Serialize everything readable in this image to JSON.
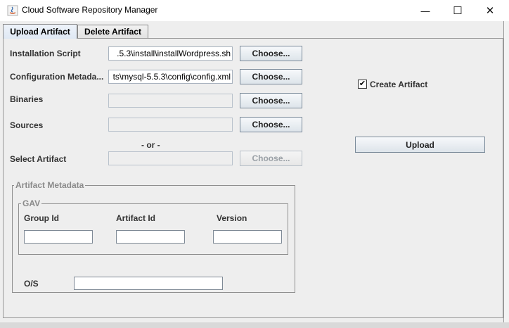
{
  "window": {
    "title": "Cloud Software Repository Manager",
    "controls": {
      "minimize": "—",
      "maximize": "☐",
      "close": "✕"
    }
  },
  "tabs": [
    {
      "label": "Upload Artifact",
      "selected": true
    },
    {
      "label": "Delete Artifact",
      "selected": false
    }
  ],
  "form": {
    "installation_script": {
      "label": "Installation Script",
      "value": ".5.3\\install\\installWordpress.sh",
      "button": "Choose..."
    },
    "configuration_metadata": {
      "label": "Configuration Metada...",
      "value": "ts\\mysql-5.5.3\\config\\config.xml",
      "button": "Choose..."
    },
    "binaries": {
      "label": "Binaries",
      "value": "",
      "button": "Choose..."
    },
    "sources": {
      "label": "Sources",
      "value": "",
      "button": "Choose..."
    },
    "or_separator": "- or -",
    "select_artifact": {
      "label": "Select Artifact",
      "value": "",
      "button": "Choose..."
    }
  },
  "artifact_metadata": {
    "title": "Artifact Metadata",
    "gav": {
      "title": "GAV",
      "group_id_label": "Group Id",
      "artifact_id_label": "Artifact Id",
      "version_label": "Version",
      "group_id_value": "",
      "artifact_id_value": "",
      "version_value": ""
    },
    "os_label": "O/S",
    "os_value": ""
  },
  "create_artifact": {
    "label": "Create Artifact",
    "checked": true,
    "mark": "✔"
  },
  "upload_button": "Upload"
}
